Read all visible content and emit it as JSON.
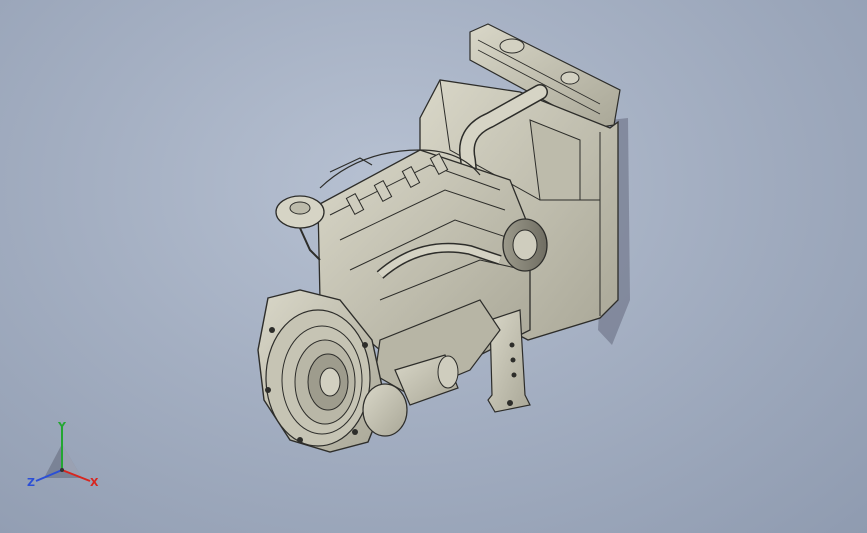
{
  "viewport": {
    "background_top": "#b7c1d2",
    "background_bottom": "#8f9bb0",
    "model_fill": "#c9c7b8",
    "model_edge": "#2d2d2a"
  },
  "triad": {
    "x_label": "X",
    "y_label": "Y",
    "z_label": "Z",
    "x_color": "#d8261f",
    "y_color": "#23a632",
    "z_color": "#2b4fd6"
  }
}
